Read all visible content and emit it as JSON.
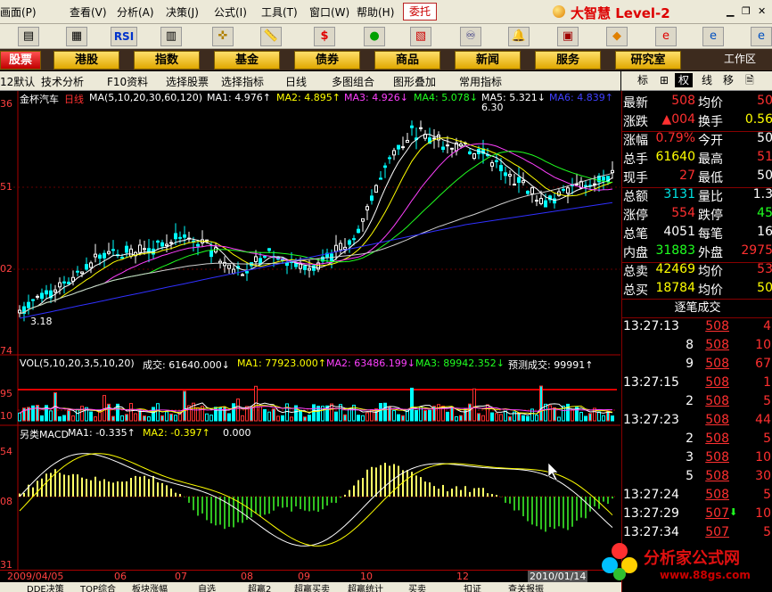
{
  "menu": {
    "items": [
      "画面(P)",
      "查看(V)",
      "分析(A)",
      "决策(J)",
      "公式(I)",
      "工具(T)",
      "窗口(W)",
      "帮助(H)"
    ],
    "weituo": "委托",
    "brand": "大智慧 Level-2"
  },
  "sections": {
    "items": [
      "股票",
      "港股",
      "指数",
      "基金",
      "债券",
      "商品",
      "新闻",
      "服务",
      "研究室"
    ],
    "workarea": "工作区"
  },
  "subbar": {
    "items": [
      "12默认",
      "技术分析",
      "F10资料",
      "选择股票",
      "选择指标",
      "日线",
      "多图组合",
      "图形叠加",
      "常用指标"
    ]
  },
  "right_tabs": [
    "标",
    "⊞",
    "权",
    "线",
    "移",
    "🗎"
  ],
  "chart": {
    "stock_name": "金杯汽车",
    "period": "日线",
    "ma_head": "MA(5,10,20,30,60,120)",
    "ma1": "MA1: 4.976↑",
    "ma2": "MA2: 4.895↑",
    "ma3": "MA3: 4.926↓",
    "ma4": "MA4: 5.078↓",
    "ma5": "MA5: 5.321↓",
    "ma6": "MA6: 4.839↑",
    "high_mark": "6.30",
    "low_mark": "3.18",
    "price_labels": [
      "36",
      "51",
      "02",
      "74"
    ],
    "vol_head": "VOL(5,10,20,3,5,10,20)",
    "vol_val": "成交: 61640.000↓",
    "vol_ma1": "MA1: 77923.000↑",
    "vol_ma2": "MA2: 63486.199↓",
    "vol_ma3": "MA3: 89942.352↓",
    "vol_forecast": "预测成交: 99991↑",
    "vol_labels": [
      "95",
      "10"
    ],
    "macd_head": "另类MACD",
    "macd_ma1": "MA1: -0.335↑",
    "macd_ma2": "MA2: -0.397↑",
    "macd_zero": "0.000",
    "macd_labels": [
      "54",
      "08",
      "31"
    ],
    "dates": [
      "2009/04/05",
      "06",
      "07",
      "08",
      "09",
      "10",
      "12",
      "2010/01/14"
    ]
  },
  "quote": {
    "rows": [
      {
        "l1": "最新",
        "v1": "508",
        "c1": "red",
        "l2": "均价",
        "v2": "50",
        "c2": "red"
      },
      {
        "l1": "涨跌",
        "v1": "▲004",
        "c1": "red",
        "l2": "换手",
        "v2": "0.56",
        "c2": "yellow"
      },
      {
        "l1": "涨幅",
        "v1": "0.79%",
        "c1": "red",
        "l2": "今开",
        "v2": "50",
        "c2": "white"
      },
      {
        "l1": "总手",
        "v1": "61640",
        "c1": "yellow",
        "l2": "最高",
        "v2": "51",
        "c2": "red"
      },
      {
        "l1": "现手",
        "v1": "27",
        "c1": "red",
        "l2": "最低",
        "v2": "50",
        "c2": "white"
      },
      {
        "l1": "总额",
        "v1": "3131",
        "c1": "cyan",
        "l2": "量比",
        "v2": "1.3",
        "c2": "white"
      },
      {
        "l1": "涨停",
        "v1": "554",
        "c1": "red",
        "l2": "跌停",
        "v2": "45",
        "c2": "green"
      },
      {
        "l1": "总笔",
        "v1": "4051",
        "c1": "white",
        "l2": "每笔",
        "v2": "16",
        "c2": "white"
      },
      {
        "l1": "内盘",
        "v1": "31883",
        "c1": "green",
        "l2": "外盘",
        "v2": "2975",
        "c2": "red"
      },
      {
        "l1": "总卖",
        "v1": "42469",
        "c1": "yellow",
        "l2": "均价",
        "v2": "53",
        "c2": "red"
      },
      {
        "l1": "总买",
        "v1": "18784",
        "c1": "yellow",
        "l2": "均价",
        "v2": "50",
        "c2": "yellow"
      }
    ]
  },
  "ticks": {
    "title": "逐笔成交",
    "rows": [
      {
        "time": "13:27:13",
        "price": "508",
        "vol": "4"
      },
      {
        "time": "",
        "price": "508",
        "vol": "10"
      },
      {
        "time": "",
        "price": "508",
        "vol": "67"
      },
      {
        "time": "13:27:15",
        "price": "508",
        "vol": "1"
      },
      {
        "time": "",
        "price": "508",
        "vol": "5"
      },
      {
        "time": "13:27:23",
        "price": "508",
        "vol": "44"
      },
      {
        "time": "",
        "price": "508",
        "vol": "5"
      },
      {
        "time": "",
        "price": "508",
        "vol": "10"
      },
      {
        "time": "",
        "price": "508",
        "vol": "30"
      },
      {
        "time": "13:27:24",
        "price": "508",
        "vol": "5"
      },
      {
        "time": "13:27:29",
        "price": "507",
        "vol": "10"
      },
      {
        "time": "13:27:34",
        "price": "507",
        "vol": "5"
      }
    ],
    "qty": [
      "",
      "8",
      "9",
      "",
      "2",
      "",
      "2",
      "3",
      "5",
      "",
      "",
      ""
    ]
  },
  "bottom_tabs": [
    "DDE决策",
    "TOP综合",
    "板块涨幅",
    "自选",
    "超赢2",
    "超赢买卖",
    "超赢统计",
    "买卖",
    "扣证",
    "查关报振"
  ],
  "watermark": {
    "text": "分析家公式网",
    "url": "www.88gs.com"
  }
}
